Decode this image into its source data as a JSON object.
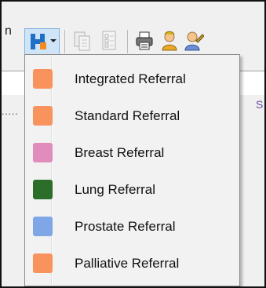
{
  "toolbar": {
    "partial_label": "n",
    "icons": [
      {
        "name": "h-referral-icon"
      },
      {
        "name": "copy-pages-icon"
      },
      {
        "name": "checklist-icon"
      },
      {
        "name": "printer-icon"
      },
      {
        "name": "user-group-icon"
      },
      {
        "name": "user-edit-icon"
      }
    ]
  },
  "content": {
    "dots": "....."
  },
  "menu": {
    "items": [
      {
        "label": "Integrated Referral",
        "color": "#f9935e"
      },
      {
        "label": "Standard Referral",
        "color": "#f9935e"
      },
      {
        "label": "Breast Referral",
        "color": "#e28bbd"
      },
      {
        "label": "Lung Referral",
        "color": "#2a6e2a"
      },
      {
        "label": "Prostate Referral",
        "color": "#7fa6e6"
      },
      {
        "label": "Palliative Referral",
        "color": "#f9935e"
      }
    ]
  }
}
